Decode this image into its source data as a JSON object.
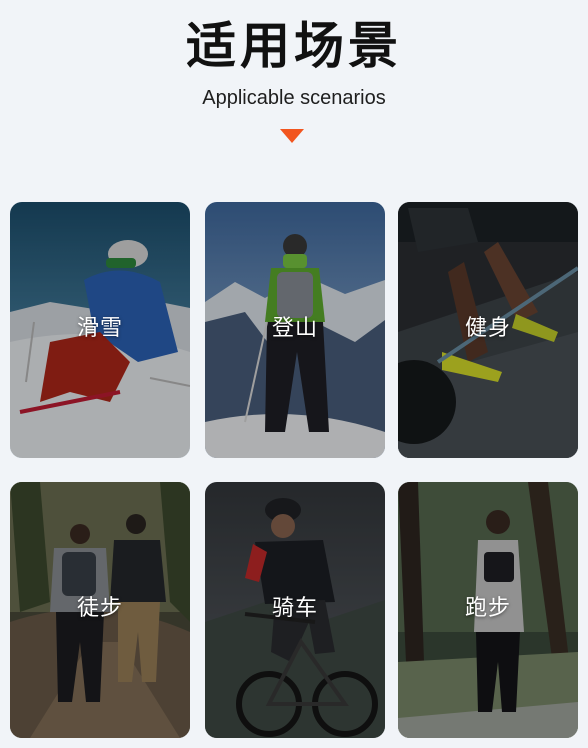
{
  "header": {
    "title": "适用场景",
    "subtitle": "Applicable scenarios"
  },
  "accent_color": "#f2551f",
  "scenarios": [
    {
      "label": "滑雪",
      "icon": "skiing-photo"
    },
    {
      "label": "登山",
      "icon": "mountaineering-photo"
    },
    {
      "label": "健身",
      "icon": "fitness-photo"
    },
    {
      "label": "徒步",
      "icon": "hiking-photo"
    },
    {
      "label": "骑车",
      "icon": "cycling-photo"
    },
    {
      "label": "跑步",
      "icon": "running-photo"
    }
  ]
}
